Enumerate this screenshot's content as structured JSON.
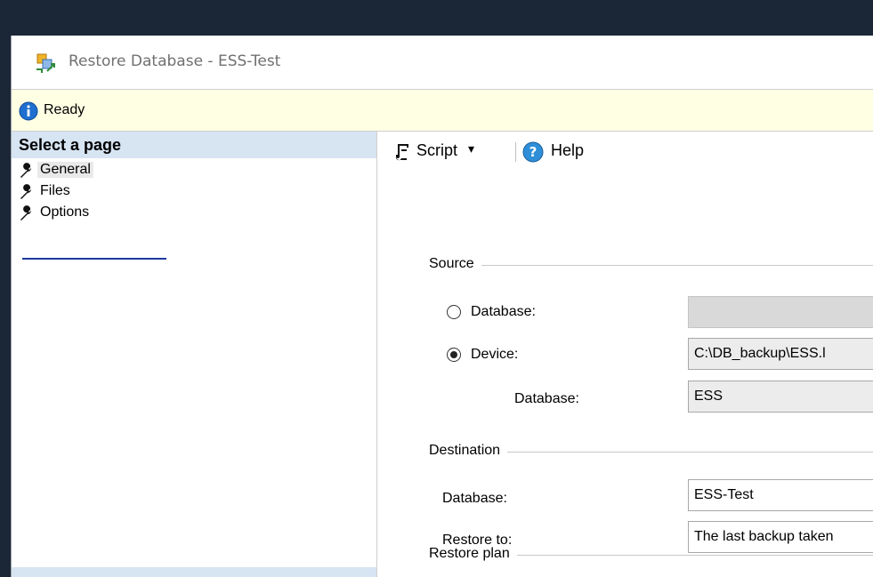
{
  "window": {
    "title": "Restore Database - ESS-Test"
  },
  "status": {
    "text": "Ready"
  },
  "select_page": {
    "header": "Select a page",
    "items": [
      {
        "label": "General"
      },
      {
        "label": "Files"
      },
      {
        "label": "Options"
      }
    ]
  },
  "toolbar": {
    "script_label": "Script",
    "help_label": "Help"
  },
  "source": {
    "title": "Source",
    "database_option": "Database:",
    "device_option": "Device:",
    "database_value": "",
    "device_value": "C:\\DB_backup\\ESS.l",
    "sub_database_label": "Database:",
    "sub_database_value": "ESS"
  },
  "destination": {
    "title": "Destination",
    "database_label": "Database:",
    "database_value": "ESS-Test",
    "restore_to_label": "Restore to:",
    "restore_to_value": "The last backup taken"
  },
  "restore_plan": {
    "title": "Restore plan"
  },
  "colors": {
    "status_bg": "#ffffe3",
    "pane_header_bg": "#d7e4f2",
    "selection_underline": "#1d3a9e"
  }
}
